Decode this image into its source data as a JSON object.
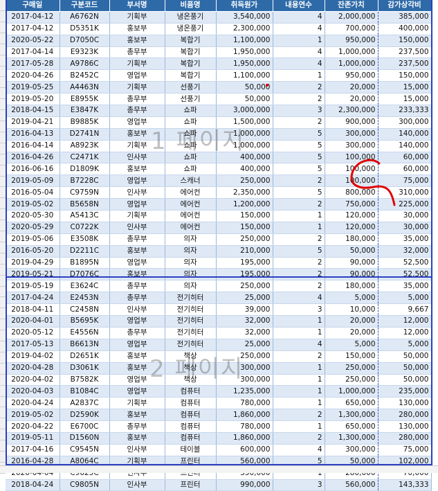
{
  "columns": [
    "구매일",
    "구분코드",
    "부서명",
    "비품명",
    "취득원가",
    "내용연수",
    "잔존가치",
    "감가상각비"
  ],
  "rows": [
    [
      "2017-04-12",
      "A6762N",
      "기획부",
      "냉온풍기",
      "3,540,000",
      "4",
      "2,000,000",
      "385,000"
    ],
    [
      "2017-04-12",
      "D5351K",
      "홍보부",
      "냉온풍기",
      "2,300,000",
      "4",
      "700,000",
      "400,000"
    ],
    [
      "2020-05-22",
      "D7050C",
      "홍보부",
      "복합기",
      "1,100,000",
      "1",
      "950,000",
      "150,000"
    ],
    [
      "2017-04-14",
      "E9323K",
      "총무부",
      "복합기",
      "1,950,000",
      "4",
      "1,000,000",
      "237,500"
    ],
    [
      "2017-05-28",
      "A9786C",
      "기획부",
      "복합기",
      "1,950,000",
      "4",
      "1,000,000",
      "237,500"
    ],
    [
      "2020-04-26",
      "B2452C",
      "영업부",
      "복합기",
      "1,100,000",
      "1",
      "950,000",
      "150,000"
    ],
    [
      "2019-05-25",
      "A4463N",
      "기획부",
      "선풍기",
      "50,000",
      "2",
      "20,000",
      "15,000"
    ],
    [
      "2019-05-20",
      "E8955K",
      "총무부",
      "선풍기",
      "50,000",
      "2",
      "20,000",
      "15,000"
    ],
    [
      "2018-04-15",
      "E3847K",
      "총무부",
      "쇼파",
      "3,000,000",
      "3",
      "2,300,000",
      "233,333"
    ],
    [
      "2019-04-21",
      "B9885K",
      "영업부",
      "쇼파",
      "1,500,000",
      "2",
      "900,000",
      "300,000"
    ],
    [
      "2016-04-13",
      "D2741N",
      "홍보부",
      "쇼파",
      "1,000,000",
      "5",
      "300,000",
      "140,000"
    ],
    [
      "2016-04-14",
      "A8923K",
      "기획부",
      "쇼파",
      "1,000,000",
      "5",
      "300,000",
      "140,000"
    ],
    [
      "2016-04-26",
      "C2471K",
      "인사부",
      "쇼파",
      "400,000",
      "5",
      "100,000",
      "60,000"
    ],
    [
      "2016-06-16",
      "D1809K",
      "홍보부",
      "쇼파",
      "400,000",
      "5",
      "100,000",
      "60,000"
    ],
    [
      "2019-05-09",
      "B7228C",
      "영업부",
      "스캐너",
      "250,000",
      "2",
      "100,000",
      "75,000"
    ],
    [
      "2016-05-04",
      "C9759N",
      "인사부",
      "에어컨",
      "2,350,000",
      "5",
      "800,000",
      "310,000"
    ],
    [
      "2019-05-02",
      "B5658N",
      "영업부",
      "에어컨",
      "1,200,000",
      "2",
      "750,000",
      "225,000"
    ],
    [
      "2020-05-30",
      "A5413C",
      "기획부",
      "에어컨",
      "150,000",
      "1",
      "120,000",
      "30,000"
    ],
    [
      "2020-05-29",
      "C0722K",
      "인사부",
      "에어컨",
      "150,000",
      "1",
      "120,000",
      "30,000"
    ],
    [
      "2019-05-06",
      "E3508K",
      "총무부",
      "의자",
      "250,000",
      "2",
      "180,000",
      "35,000"
    ],
    [
      "2016-05-20",
      "D2211C",
      "홍보부",
      "의자",
      "210,000",
      "5",
      "50,000",
      "32,000"
    ],
    [
      "2019-04-29",
      "B1895N",
      "영업부",
      "의자",
      "195,000",
      "2",
      "90,000",
      "52,500"
    ],
    [
      "2019-05-21",
      "D7076C",
      "홍보부",
      "의자",
      "195,000",
      "2",
      "90,000",
      "52,500"
    ],
    [
      "2019-05-19",
      "E3624C",
      "총무부",
      "의자",
      "250,000",
      "2",
      "180,000",
      "35,000"
    ],
    [
      "2017-04-24",
      "E2453N",
      "총무부",
      "전기히터",
      "25,000",
      "4",
      "5,000",
      "5,000"
    ],
    [
      "2018-04-11",
      "C2458N",
      "인사부",
      "전기히터",
      "39,000",
      "3",
      "10,000",
      "9,667"
    ],
    [
      "2020-04-01",
      "B5695K",
      "영업부",
      "전기히터",
      "32,000",
      "1",
      "20,000",
      "12,000"
    ],
    [
      "2020-05-12",
      "E4556N",
      "총무부",
      "전기히터",
      "32,000",
      "1",
      "20,000",
      "12,000"
    ],
    [
      "2017-05-13",
      "B6613N",
      "영업부",
      "전기히터",
      "25,000",
      "4",
      "5,000",
      "5,000"
    ],
    [
      "2019-04-02",
      "D2651K",
      "홍보부",
      "책상",
      "250,000",
      "2",
      "150,000",
      "50,000"
    ],
    [
      "2020-04-28",
      "D3061K",
      "홍보부",
      "책상",
      "300,000",
      "1",
      "250,000",
      "50,000"
    ],
    [
      "2020-04-02",
      "B7582K",
      "영업부",
      "책상",
      "300,000",
      "1",
      "250,000",
      "50,000"
    ],
    [
      "2020-04-03",
      "B1084C",
      "영업부",
      "컴퓨터",
      "1,235,000",
      "1",
      "1,000,000",
      "235,000"
    ],
    [
      "2020-04-24",
      "A2837C",
      "기획부",
      "컴퓨터",
      "780,000",
      "1",
      "650,000",
      "130,000"
    ],
    [
      "2019-05-02",
      "D2590K",
      "홍보부",
      "컴퓨터",
      "1,860,000",
      "2",
      "1,300,000",
      "280,000"
    ],
    [
      "2020-04-22",
      "E6700C",
      "총무부",
      "컴퓨터",
      "780,000",
      "1",
      "650,000",
      "130,000"
    ],
    [
      "2019-05-11",
      "D1560N",
      "홍보부",
      "컴퓨터",
      "1,860,000",
      "2",
      "1,300,000",
      "280,000"
    ],
    [
      "2017-04-16",
      "C9545N",
      "인사부",
      "테이블",
      "600,000",
      "4",
      "300,000",
      "75,000"
    ],
    [
      "2016-04-28",
      "A8064C",
      "기획부",
      "프린터",
      "560,000",
      "5",
      "50,000",
      "102,000"
    ],
    [
      "2020-04-04",
      "C9625C",
      "인사부",
      "프린터",
      "350,000",
      "1",
      "280,000",
      "70,000"
    ],
    [
      "2018-04-24",
      "C9805N",
      "인사부",
      "프린터",
      "990,000",
      "3",
      "560,000",
      "143,333"
    ]
  ],
  "watermarks": [
    "1 페이지",
    "2 페이지"
  ],
  "colors": {
    "header_bg": "#2e6aa8",
    "band": "#dfe9f6",
    "page_break": "#2a3fbf",
    "annotation": "#e00000"
  }
}
